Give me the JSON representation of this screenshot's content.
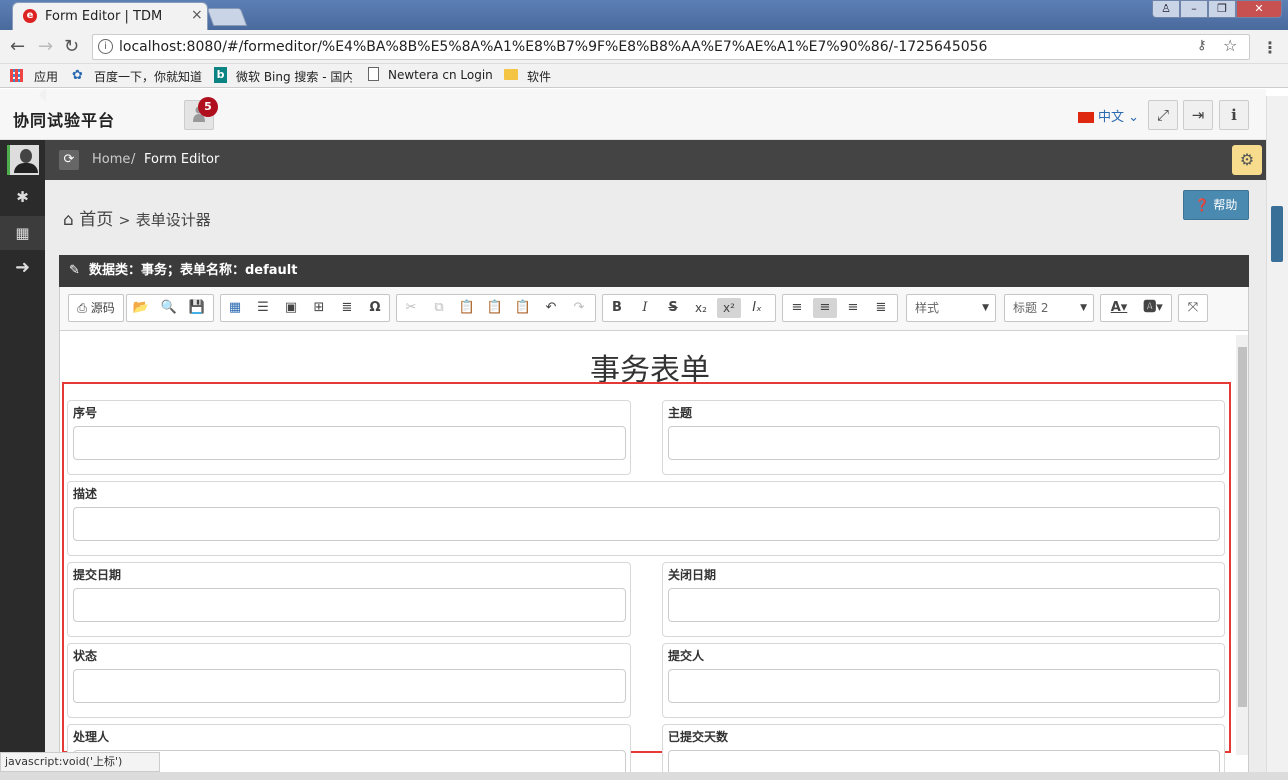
{
  "browser": {
    "tab_title": "Form Editor | TDM",
    "tab_favicon": "e",
    "url": "localhost:8080/#/formeditor/%E4%BA%8B%E5%8A%A1%E8%B7%9F%E8%B8%AA%E7%AE%A1%E7%90%86/-1725645056",
    "bookmarks": [
      "应用",
      "百度一下，你就知道",
      "微软 Bing 搜索 - 国内",
      "Newtera cn Login",
      "软件"
    ],
    "status_tip": "javascript:void('上标')"
  },
  "header": {
    "app_title": "协同试验平台",
    "notification_count": "5",
    "language": "中文"
  },
  "breadcrumb": {
    "home": "Home",
    "separator": "/",
    "current": "Form Editor"
  },
  "page": {
    "home_link": "首页",
    "arrow": ">",
    "section": "表单设计器",
    "help_label": "帮助",
    "panel_title": "数据类：事务；表单名称：default"
  },
  "toolbar": {
    "source_label": "源码",
    "style_combo": "样式",
    "format_combo": "标题 2"
  },
  "form": {
    "title": "事务表单",
    "fields": [
      "序号",
      "主题",
      "描述",
      "提交日期",
      "关闭日期",
      "状态",
      "提交人",
      "处理人",
      "已提交天数"
    ]
  },
  "colors": {
    "highlight_border": "#e53935",
    "sidebar": "#2b2b2b",
    "badge": "#b0101d",
    "help_button": "#4a8ab0"
  }
}
